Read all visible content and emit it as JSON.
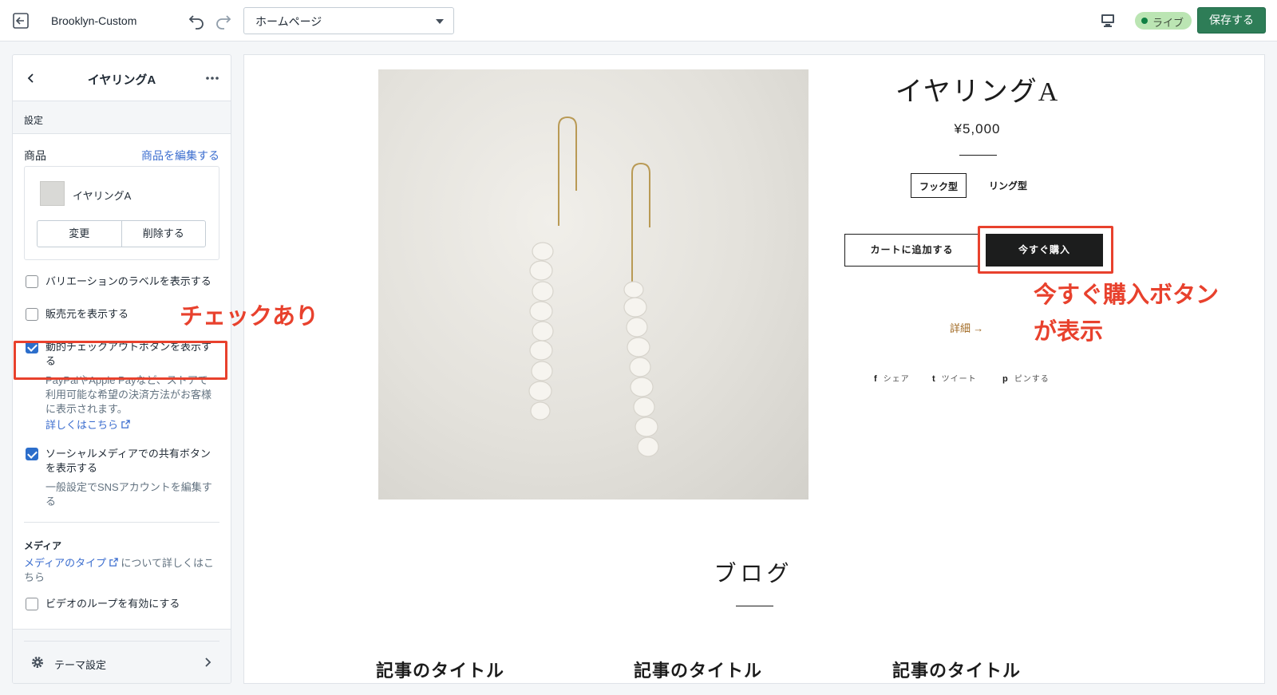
{
  "topbar": {
    "theme_name": "Brooklyn-Custom",
    "page_select_value": "ホームページ",
    "live_label": "ライブ",
    "save_label": "保存する"
  },
  "sidebar": {
    "title": "イヤリングA",
    "section_label": "設定",
    "product_label": "商品",
    "edit_product_link": "商品を編集する",
    "product_name": "イヤリングA",
    "change_button": "変更",
    "delete_button": "削除する",
    "options": [
      {
        "label": "バリエーションのラベルを表示する",
        "checked": false
      },
      {
        "label": "販売元を表示する",
        "checked": false
      },
      {
        "label": "動的チェックアウトボタンを表示する",
        "checked": true
      },
      {
        "label": "ソーシャルメディアでの共有ボタンを表示する",
        "checked": true
      },
      {
        "label": "ビデオのループを有効にする",
        "checked": false
      }
    ],
    "dynamic_checkout_help": "PayPalやApple Payなど、ストアで利用可能な希望の決済方法がお客様に表示されます。",
    "learn_more_link": "詳しくはこちら",
    "social_help": "一般設定でSNSアカウントを編集する",
    "media_label": "メディア",
    "media_type_link": "メディアのタイプ",
    "media_type_suffix": "について詳しくはこちら",
    "theme_settings": "テーマ設定"
  },
  "preview": {
    "product_title": "イヤリングA",
    "price": "¥5,000",
    "variants": [
      "フック型",
      "リング型"
    ],
    "add_to_cart": "カートに追加する",
    "buy_now": "今すぐ購入",
    "details_link": "詳細 →",
    "share_links": [
      {
        "icon": "facebook-icon",
        "glyph": "f",
        "label": "シェア"
      },
      {
        "icon": "twitter-icon",
        "glyph": "t",
        "label": "ツイート"
      },
      {
        "icon": "pinterest-icon",
        "glyph": "p",
        "label": "ピンする"
      }
    ],
    "blog_title": "ブログ",
    "article_titles": [
      "記事のタイトル",
      "記事のタイトル",
      "記事のタイトル"
    ]
  },
  "annotations": {
    "checked_note": "チェックあり",
    "buy_button_note_line1": "今すぐ購入ボタン",
    "buy_button_note_line2": "が表示"
  },
  "colors": {
    "accent_blue": "#3c6ecf",
    "save_green": "#2e7d57",
    "annotation_red": "#e8412d",
    "buy_now_bg": "#1c1d1d"
  }
}
